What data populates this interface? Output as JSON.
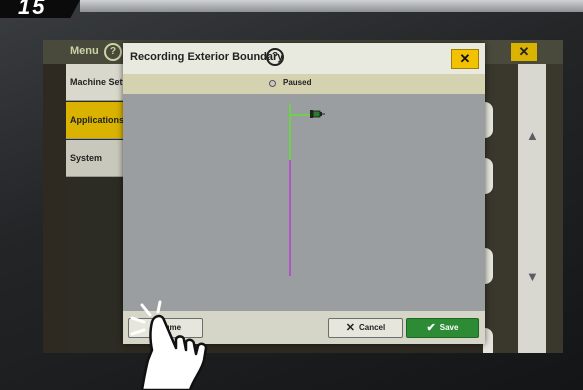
{
  "device": {
    "corner_label": "15"
  },
  "background": {
    "menu_label": "Menu",
    "help_symbol": "?",
    "close_symbol": "✕",
    "sidebar": [
      {
        "label": "Machine Setti",
        "state": "normal"
      },
      {
        "label": "Applications",
        "state": "active"
      },
      {
        "label": "System",
        "state": "normal"
      }
    ],
    "scroll_up": "▲",
    "scroll_down": "▼"
  },
  "dialog": {
    "title": "Recording Exterior Boundary",
    "help_symbol": "?",
    "close_symbol": "✕",
    "status": "Paused",
    "buttons": {
      "resume": "Resume",
      "cancel": "Cancel",
      "save": "Save"
    },
    "icons": {
      "cancel": "✕",
      "save": "✔"
    }
  },
  "colors": {
    "accent": "#f2c200",
    "save": "#2e8b35",
    "path_recorded": "#6fd14a",
    "path_planned": "#b055c8"
  }
}
